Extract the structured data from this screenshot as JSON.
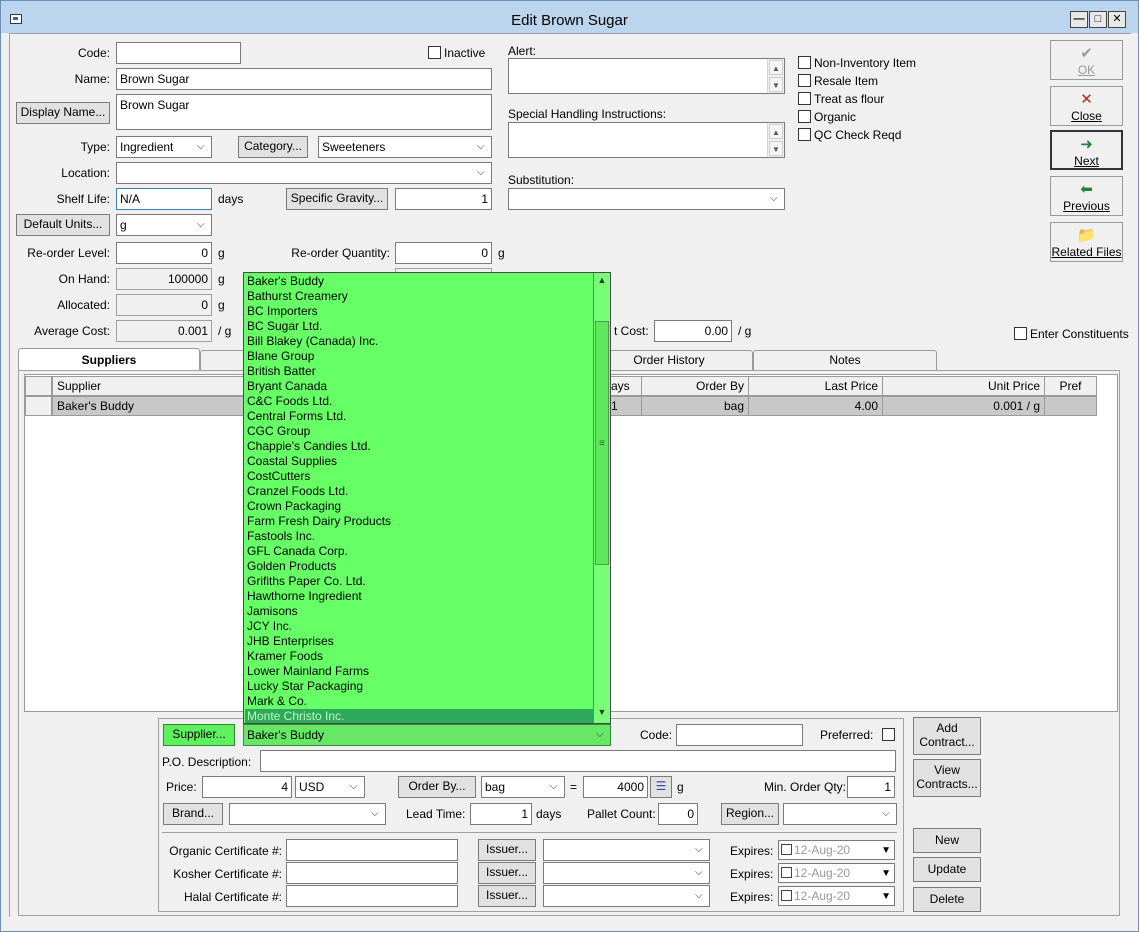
{
  "window": {
    "title": "Edit Brown Sugar"
  },
  "general": {
    "code_label": "Code:",
    "code_value": "",
    "inactive_label": "Inactive",
    "name_label": "Name:",
    "name_value": "Brown Sugar",
    "display_name_button": "Display Name...",
    "display_name_value": "Brown Sugar",
    "type_label": "Type:",
    "type_value": "Ingredient",
    "category_button": "Category...",
    "category_value": "Sweeteners",
    "location_label": "Location:",
    "location_value": "",
    "shelf_life_label": "Shelf Life:",
    "shelf_life_value": "N/A",
    "shelf_life_unit": "days",
    "specific_gravity_button": "Specific Gravity...",
    "specific_gravity_value": "1",
    "default_units_button": "Default Units...",
    "default_units_value": "g",
    "reorder_level_label": "Re-order Level:",
    "reorder_level_value": "0",
    "reorder_level_unit": "g",
    "reorder_qty_label": "Re-order Quantity:",
    "reorder_qty_value": "0",
    "reorder_qty_unit": "g",
    "on_hand_label": "On Hand:",
    "on_hand_value": "100000",
    "on_hand_unit": "g",
    "allocated_label": "Allocated:",
    "allocated_value": "0",
    "allocated_unit": "g",
    "avg_cost_label": "Average Cost:",
    "avg_cost_value": "0.001",
    "avg_cost_unit": "/ g",
    "last_cost_label": "t Cost:",
    "last_cost_value": "0.00",
    "last_cost_unit": "/ g",
    "alert_label": "Alert:",
    "special_handling_label": "Special Handling Instructions:",
    "substitution_label": "Substitution:",
    "substitution_value": "",
    "enter_constituents_label": "Enter Constituents"
  },
  "flags": [
    {
      "label": "Non-Inventory Item"
    },
    {
      "label": "Resale Item"
    },
    {
      "label": "Treat as flour"
    },
    {
      "label": "Organic"
    },
    {
      "label": "QC Check Reqd"
    }
  ],
  "side_buttons": {
    "ok": "OK",
    "close": "Close",
    "next": "Next",
    "previous": "Previous",
    "related_files": "Related Files"
  },
  "tabs": {
    "suppliers": "Suppliers",
    "order_history": "Order History",
    "notes": "Notes"
  },
  "grid": {
    "headers": {
      "supplier": "Supplier",
      "days": "ays",
      "order_by": "Order By",
      "last_price": "Last Price",
      "unit_price": "Unit Price",
      "pref": "Pref"
    },
    "row": {
      "supplier": "Baker's Buddy",
      "days": "1",
      "order_by": "bag",
      "last_price": "4.00",
      "unit_price": "0.001 / g",
      "pref": ""
    }
  },
  "supplier_dropdown": {
    "items": [
      "Baker's Buddy",
      "Bathurst Creamery",
      "BC Importers",
      "BC Sugar Ltd.",
      "Bill Blakey (Canada) Inc.",
      "Blane Group",
      "British Batter",
      "Bryant Canada",
      "C&C Foods Ltd.",
      "Central Forms Ltd.",
      "CGC Group",
      "Chappie's Candies Ltd.",
      "Coastal Supplies",
      "CostCutters",
      "Cranzel Foods Ltd.",
      "Crown Packaging",
      "Farm Fresh Dairy Products",
      "Fastools Inc.",
      "GFL Canada Corp.",
      "Golden Products",
      "Grifiths Paper Co. Ltd.",
      "Hawthorne Ingredient",
      "Jamisons",
      "JCY Inc.",
      "JHB Enterprises",
      "Kramer Foods",
      "Lower Mainland Farms",
      "Lucky Star Packaging",
      "Mark & Co.",
      "Monte Christo Inc."
    ],
    "highlighted": "Monte Christo Inc."
  },
  "supplier_detail": {
    "supplier_button": "Supplier...",
    "supplier_value": "Baker's Buddy",
    "code_label": "Code:",
    "code_value": "",
    "preferred_label": "Preferred:",
    "po_description_label": "P.O. Description:",
    "po_description_value": "",
    "price_label": "Price:",
    "price_value": "4",
    "currency_value": "USD",
    "order_by_button": "Order By...",
    "order_by_value": "bag",
    "equals": "=",
    "conversion_value": "4000",
    "conversion_unit": "g",
    "min_order_label": "Min. Order Qty:",
    "min_order_value": "1",
    "brand_button": "Brand...",
    "brand_value": "",
    "lead_time_label": "Lead Time:",
    "lead_time_value": "1",
    "lead_time_unit": "days",
    "pallet_count_label": "Pallet Count:",
    "pallet_count_value": "0",
    "region_button": "Region...",
    "region_value": "",
    "add_contract_button_line1": "Add",
    "add_contract_button_line2": "Contract...",
    "view_contracts_button_line1": "View",
    "view_contracts_button_line2": "Contracts...",
    "organic_cert_label": "Organic Certificate #:",
    "kosher_cert_label": "Kosher Certificate #:",
    "halal_cert_label": "Halal Certificate #:",
    "issuer_button": "Issuer...",
    "expires_label": "Expires:",
    "expires_value": "12-Aug-20",
    "new_button": "New",
    "update_button": "Update",
    "delete_button": "Delete"
  }
}
